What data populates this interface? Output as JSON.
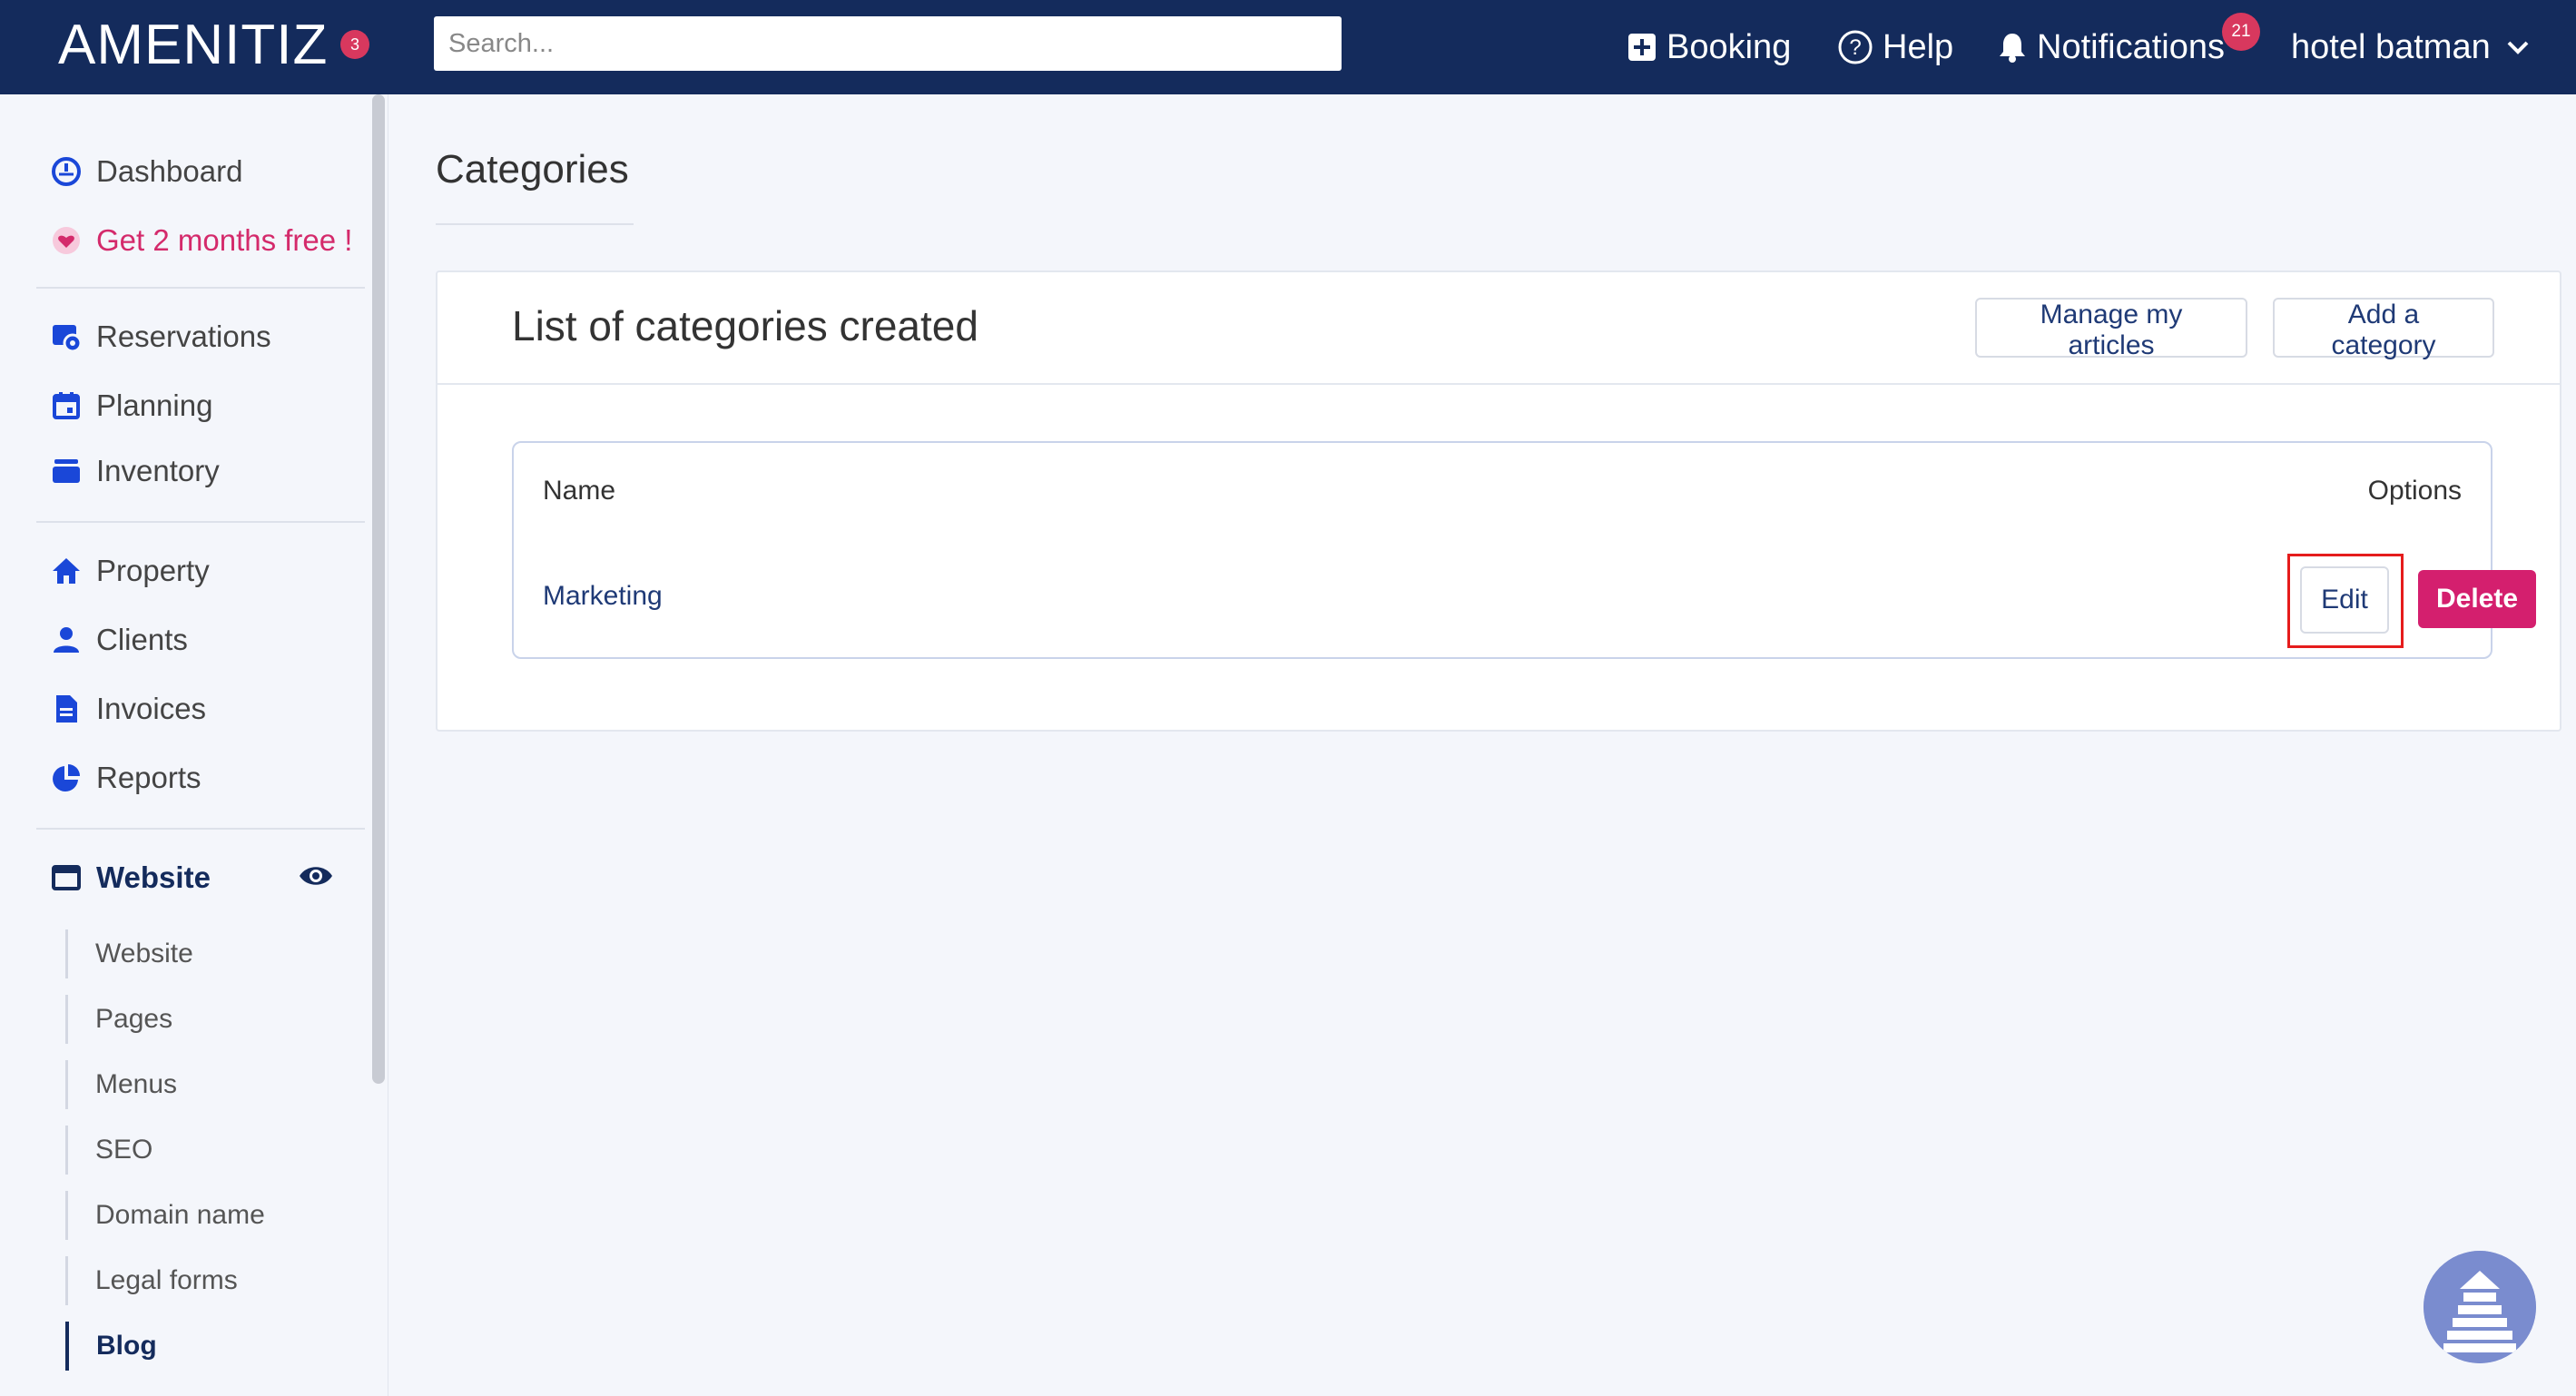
{
  "header": {
    "logo": "AMENITIZ",
    "logo_badge": "3",
    "search_placeholder": "Search...",
    "booking": "Booking",
    "help": "Help",
    "notifications": "Notifications",
    "notifications_count": "21",
    "user": "hotel batman"
  },
  "sidebar": {
    "items": [
      {
        "label": "Dashboard",
        "icon": "dashboard-icon"
      },
      {
        "label": "Get 2 months free !",
        "icon": "heart-icon"
      },
      {
        "label": "Reservations",
        "icon": "reservations-icon"
      },
      {
        "label": "Planning",
        "icon": "calendar-icon"
      },
      {
        "label": "Inventory",
        "icon": "inventory-icon"
      },
      {
        "label": "Property",
        "icon": "home-icon"
      },
      {
        "label": "Clients",
        "icon": "users-icon"
      },
      {
        "label": "Invoices",
        "icon": "invoice-icon"
      },
      {
        "label": "Reports",
        "icon": "pie-chart-icon"
      },
      {
        "label": "Website",
        "icon": "window-icon"
      }
    ],
    "sub_items": [
      "Website",
      "Pages",
      "Menus",
      "SEO",
      "Domain name",
      "Legal forms",
      "Blog"
    ],
    "active_sub_item": "Blog"
  },
  "main": {
    "title": "Categories",
    "card_title": "List of categories created",
    "manage_button": "Manage my articles",
    "add_button": "Add a category",
    "table": {
      "headers": [
        "Name",
        "Options"
      ],
      "rows": [
        {
          "name": "Marketing",
          "edit": "Edit",
          "delete": "Delete"
        }
      ]
    }
  },
  "colors": {
    "topbar": "#142b5c",
    "accent_pink": "#d41f6e",
    "link_blue": "#1f3a76",
    "highlight_red": "#e51c1c"
  }
}
